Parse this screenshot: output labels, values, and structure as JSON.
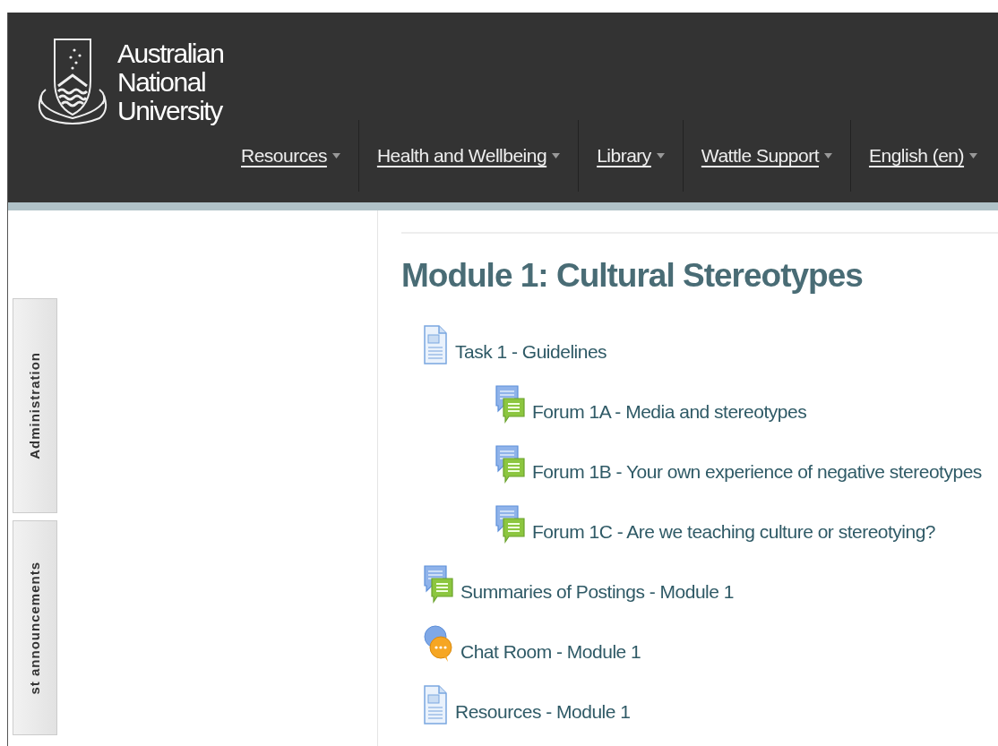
{
  "header": {
    "logo_lines": [
      "Australian",
      "National",
      "University"
    ],
    "nav": [
      {
        "label": "Resources"
      },
      {
        "label": "Health and Wellbeing"
      },
      {
        "label": "Library"
      },
      {
        "label": "Wattle Support"
      },
      {
        "label": "English (en)"
      }
    ]
  },
  "side_tabs": [
    {
      "label": "Administration"
    },
    {
      "label": "st announcements"
    }
  ],
  "section": {
    "title": "Module 1: Cultural Stereotypes",
    "activities": [
      {
        "kind": "page",
        "label": "Task 1 - Guidelines",
        "children": [
          {
            "kind": "forum",
            "label": "Forum 1A - Media and stereotypes"
          },
          {
            "kind": "forum",
            "label": "Forum 1B - Your own experience of negative stereotypes"
          },
          {
            "kind": "forum",
            "label": "Forum 1C - Are we teaching culture or stereotying?"
          }
        ]
      },
      {
        "kind": "forum",
        "label": "Summaries of Postings - Module 1"
      },
      {
        "kind": "chat",
        "label": "Chat Room - Module 1"
      },
      {
        "kind": "page",
        "label": "Resources - Module 1"
      }
    ]
  }
}
